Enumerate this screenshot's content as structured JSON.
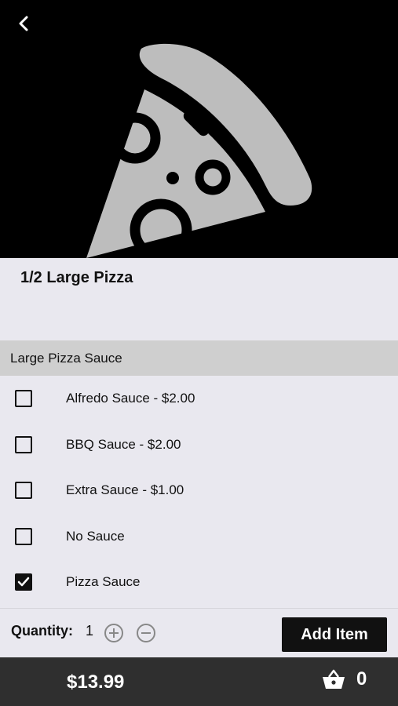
{
  "item": {
    "title": "1/2 Large Pizza",
    "image_icon": "pizza-slice-icon"
  },
  "section": {
    "header": "Large Pizza Sauce",
    "options": [
      {
        "label": "Alfredo Sauce - $2.00",
        "checked": false
      },
      {
        "label": "BBQ Sauce - $2.00",
        "checked": false
      },
      {
        "label": "Extra Sauce - $1.00",
        "checked": false
      },
      {
        "label": "No Sauce",
        "checked": false
      },
      {
        "label": "Pizza Sauce",
        "checked": true
      }
    ]
  },
  "quantity": {
    "label": "Quantity:",
    "value": "1"
  },
  "actions": {
    "add_item_label": "Add Item"
  },
  "footer": {
    "total": "$13.99",
    "cart_count": "0"
  },
  "colors": {
    "background": "#e9e8ef",
    "hero_background": "#000000",
    "pizza_gray": "#bdbdbd",
    "section_header": "#cfcfcf",
    "footer": "#2f2f2f",
    "button": "#111111"
  }
}
